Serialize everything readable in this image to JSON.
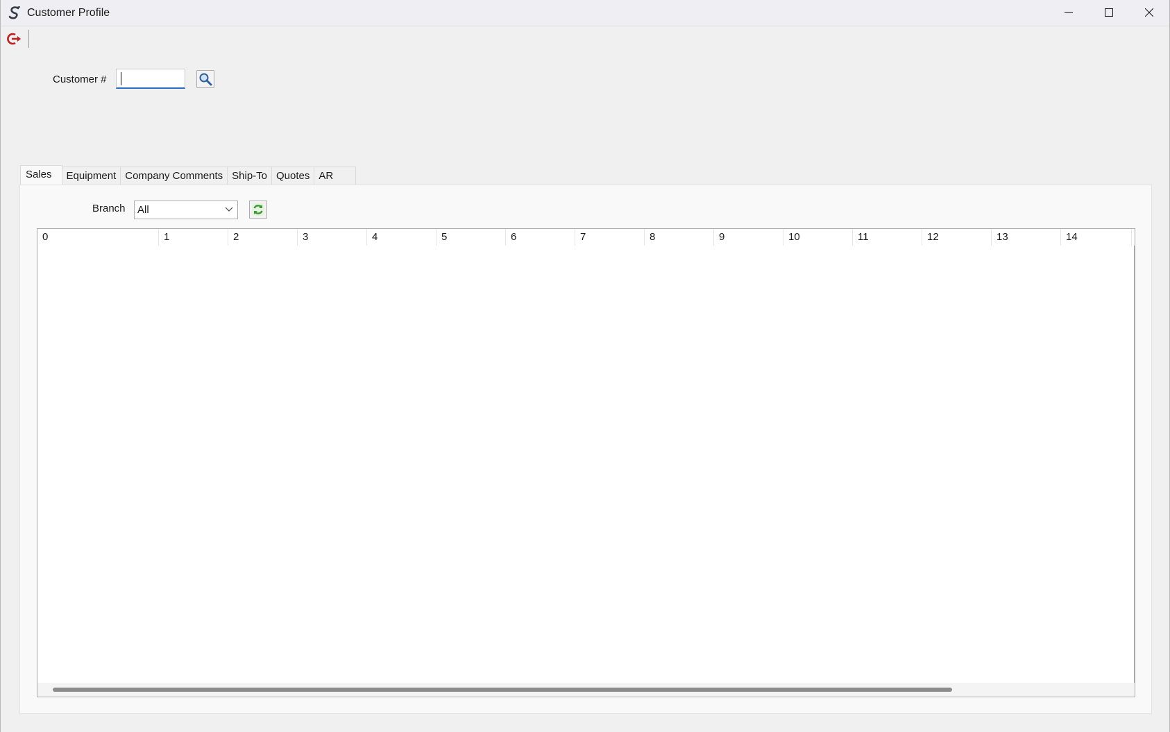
{
  "window": {
    "title": "Customer Profile"
  },
  "customer": {
    "label": "Customer #",
    "value": "",
    "placeholder": ""
  },
  "tabs": [
    {
      "label": "Sales",
      "active": true
    },
    {
      "label": "Equipment",
      "active": false
    },
    {
      "label": "Company Comments",
      "active": false
    },
    {
      "label": "Ship-To",
      "active": false
    },
    {
      "label": "Quotes",
      "active": false
    },
    {
      "label": "AR",
      "active": false
    }
  ],
  "branch": {
    "label": "Branch",
    "selected": "All"
  },
  "grid": {
    "columns": [
      "0",
      "1",
      "2",
      "3",
      "4",
      "5",
      "6",
      "7",
      "8",
      "9",
      "10",
      "11",
      "12",
      "13",
      "14"
    ],
    "rows": []
  },
  "colors": {
    "accent": "#2b6cc4",
    "exit_icon": "#c0201f",
    "refresh_icon": "#3a9a2f"
  },
  "icons": {
    "app": "s-logo-icon",
    "exit": "exit-icon",
    "search": "magnifier-icon",
    "refresh": "refresh-icon",
    "dropdown": "chevron-down-icon"
  }
}
